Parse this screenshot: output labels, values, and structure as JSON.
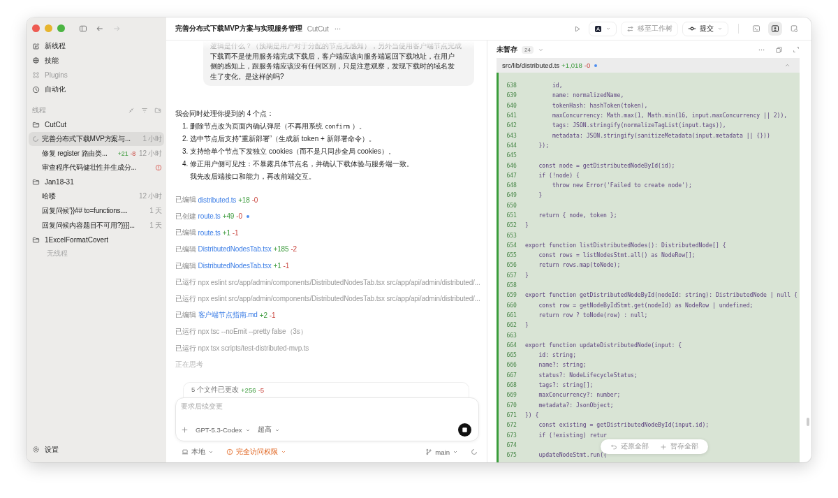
{
  "window": {
    "title": "完善分布式下载MVP方案与实现服务管理",
    "project": "CutCut"
  },
  "sidebar": {
    "nav": [
      {
        "label": "新线程",
        "disabled": false
      },
      {
        "label": "技能",
        "disabled": false
      },
      {
        "label": "Plugins",
        "disabled": true
      },
      {
        "label": "自动化",
        "disabled": false
      }
    ],
    "section_title": "线程",
    "groups": [
      {
        "name": "CutCut",
        "threads": [
          {
            "title": "完善分布式下载MVP方案与...",
            "time": "1 小时",
            "running": true,
            "error": false,
            "selected": true
          },
          {
            "title": "修复 register 路由类...",
            "added": "+21",
            "removed": "-8",
            "time": "12 小时",
            "running": false,
            "error": false,
            "selected": false
          },
          {
            "title": "审查程序代码健壮性并生成分...",
            "running": false,
            "error": true,
            "selected": false
          }
        ]
      },
      {
        "name": "Jan18-31",
        "threads": [
          {
            "title": "哈喽",
            "time": "12 小时",
            "running": false,
            "error": false,
            "selected": false
          },
          {
            "title": "回复问候'}}## to=functions....",
            "time": "1 天",
            "running": false,
            "error": false,
            "selected": false
          },
          {
            "title": "回复问候内容题目不可用?}}}]...",
            "time": "1 天",
            "running": false,
            "error": false,
            "selected": false
          }
        ]
      },
      {
        "name": "1ExcelFormatCovert",
        "empty_text": "无线程"
      }
    ],
    "settings": "设置"
  },
  "conversation": {
    "user_message": [
      "逻辑是什么？（预期是用户对于分配的节点无感知），另外当使用客户端节点完成",
      "下载而不是使用服务端完成下载后，客户端应该向服务端返回下载地址，在用户",
      "侧的感知上，跟服务端应该没有任何区别，只是注意观察，发现下载时的域名发",
      "生了变化。是这样的吗?"
    ],
    "reply": {
      "intro": "我会同时处理你提到的 4 个点：",
      "items": [
        {
          "number": "1.",
          "text": "删除节点改为页面内确认弹层（不再用系统",
          "code": "confirm",
          "after": "）。"
        },
        {
          "number": "2.",
          "text": "选中节点后支持“重新部署”（生成新 token + 新部署命令）。"
        },
        {
          "number": "3.",
          "text": "支持给单个节点下发独立 cookies（而不是只同步全局 cookies）。"
        },
        {
          "number": "4.",
          "text": "修正用户侧可见性：不暴露具体节点名，并确认下载体验与服务端一致。",
          "continuation": "我先改后端接口和能力，再改前端交互。"
        }
      ]
    },
    "activity": [
      {
        "kind": "file",
        "verb": "已编辑",
        "target": "distributed.ts",
        "added": "+18",
        "removed": "-0",
        "dot": false
      },
      {
        "kind": "file",
        "verb": "已创建",
        "target": "route.ts",
        "added": "+49",
        "removed": "-0",
        "dot": true
      },
      {
        "kind": "file",
        "verb": "已编辑",
        "target": "route.ts",
        "added": "+1",
        "removed": "-1",
        "dot": false
      },
      {
        "kind": "file",
        "verb": "已编辑",
        "target": "DistributedNodesTab.tsx",
        "added": "+185",
        "removed": "-2",
        "dot": false
      },
      {
        "kind": "file",
        "verb": "已编辑",
        "target": "DistributedNodesTab.tsx",
        "added": "+1",
        "removed": "-1",
        "dot": false
      },
      {
        "kind": "command",
        "verb": "已运行",
        "target": "npx eslint src/app/admin/components/DistributedNodesTab.tsx src/app/api/admin/distributed/...",
        "dot": false
      },
      {
        "kind": "command",
        "verb": "已运行",
        "target": "npx eslint src/app/admin/components/DistributedNodesTab.tsx src/app/api/admin/distributed/...",
        "dot": false
      },
      {
        "kind": "file",
        "verb": "已编辑",
        "target": "客户端节点指南.md",
        "added": "+2",
        "removed": "-1",
        "dot": false
      },
      {
        "kind": "command",
        "verb": "已运行",
        "target": "npx tsc --noEmit --pretty false（3s）",
        "dot": false
      },
      {
        "kind": "command",
        "verb": "已运行",
        "target": "npx tsx scripts/test-distributed-mvp.ts",
        "dot": false
      }
    ],
    "thinking": "正在思考",
    "changes": {
      "label": "5 个文件已更改",
      "added": "+256",
      "removed": "-5"
    },
    "composer": {
      "placeholder": "要求后续变更",
      "model": "GPT-5.3-Codex",
      "effort": "超高"
    },
    "footer": {
      "location": "本地",
      "permission": "完全访问权限",
      "branch": "main"
    }
  },
  "diff_panel": {
    "toolbar": {
      "worktree": "移至工作树",
      "commit": "提交"
    },
    "title": "未暂存",
    "count": "24",
    "file": {
      "path": "src/lib/distributed.ts",
      "added": "+1,018",
      "removed": "-0",
      "dot": true
    },
    "lines": [
      {
        "n": "638",
        "code": "        id,"
      },
      {
        "n": "639",
        "code": "        name: normalizedName,"
      },
      {
        "n": "640",
        "code": "        tokenHash: hashToken(token),"
      },
      {
        "n": "641",
        "code": "        maxConcurrency: Math.max(1, Math.min(16, input.maxConcurrency || 2)),"
      },
      {
        "n": "642",
        "code": "        tags: JSON.stringify(normalizeTagList(input.tags)),"
      },
      {
        "n": "643",
        "code": "        metadata: JSON.stringify(sanitizeMetadata(input.metadata || {}))"
      },
      {
        "n": "644",
        "code": "    });"
      },
      {
        "n": "645"
      },
      {
        "n": "646",
        "code": "    const node = getDistributedNodeById(id);"
      },
      {
        "n": "647",
        "code": "    if (!node) {"
      },
      {
        "n": "648",
        "code": "        throw new Error('Failed to create node');"
      },
      {
        "n": "649",
        "code": "    }"
      },
      {
        "n": "650"
      },
      {
        "n": "651",
        "code": "    return { node, token };"
      },
      {
        "n": "652",
        "code": "}"
      },
      {
        "n": "653"
      },
      {
        "n": "654",
        "code": "export function listDistributedNodes(): DistributedNode[] {"
      },
      {
        "n": "655",
        "code": "    const rows = listNodesStmt.all() as NodeRow[];"
      },
      {
        "n": "656",
        "code": "    return rows.map(toNode);"
      },
      {
        "n": "657",
        "code": "}"
      },
      {
        "n": "658"
      },
      {
        "n": "659",
        "code": "export function getDistributedNodeById(nodeId: string): DistributedNode | null {"
      },
      {
        "n": "660",
        "code": "    const row = getNodeByIdStmt.get(nodeId) as NodeRow | undefined;"
      },
      {
        "n": "661",
        "code": "    return row ? toNode(row) : null;"
      },
      {
        "n": "662",
        "code": "}"
      },
      {
        "n": "663"
      },
      {
        "n": "664",
        "code": "export function updateDistributedNode(input: {"
      },
      {
        "n": "665",
        "code": "    id: string;"
      },
      {
        "n": "666",
        "code": "    name?: string;"
      },
      {
        "n": "667",
        "code": "    status?: NodeLifecycleStatus;"
      },
      {
        "n": "668",
        "code": "    tags?: string[];"
      },
      {
        "n": "669",
        "code": "    maxConcurrency?: number;"
      },
      {
        "n": "670",
        "code": "    metadata?: JsonObject;"
      },
      {
        "n": "671",
        "code": "}) {"
      },
      {
        "n": "672",
        "code": "    const existing = getDistributedNodeById(input.id);"
      },
      {
        "n": "673",
        "code": "    if (!existing) retur"
      },
      {
        "n": "674"
      },
      {
        "n": "675",
        "code": "    updateNodeStmt.run({"
      }
    ],
    "floating": {
      "revert": "还原全部",
      "stage": "暂存全部"
    }
  }
}
